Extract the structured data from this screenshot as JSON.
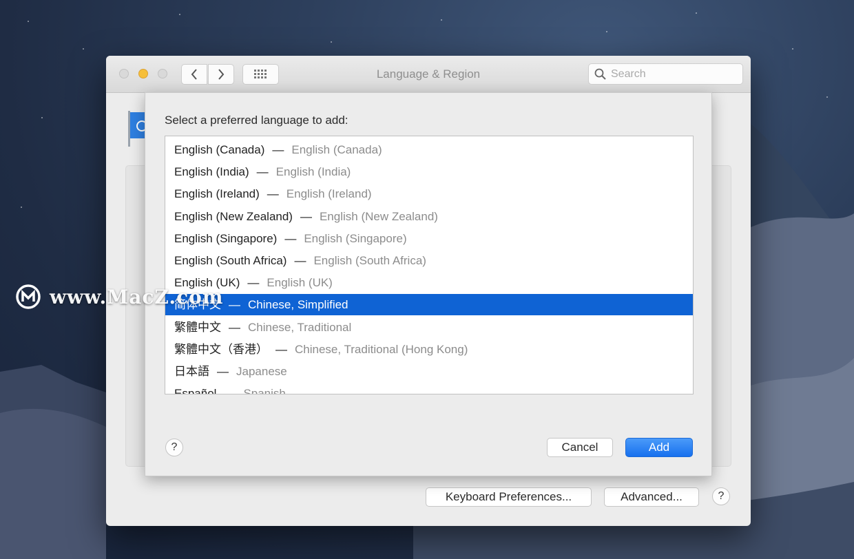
{
  "window": {
    "title": "Language & Region",
    "search_placeholder": "Search"
  },
  "sheet": {
    "prompt": "Select a preferred language to add:",
    "languages": [
      {
        "native": "English (Canada)",
        "english": "English (Canada)",
        "selected": false
      },
      {
        "native": "English (India)",
        "english": "English (India)",
        "selected": false
      },
      {
        "native": "English (Ireland)",
        "english": "English (Ireland)",
        "selected": false
      },
      {
        "native": "English (New Zealand)",
        "english": "English (New Zealand)",
        "selected": false
      },
      {
        "native": "English (Singapore)",
        "english": "English (Singapore)",
        "selected": false
      },
      {
        "native": "English (South Africa)",
        "english": "English (South Africa)",
        "selected": false
      },
      {
        "native": "English (UK)",
        "english": "English (UK)",
        "selected": false
      },
      {
        "native": "简体中文",
        "english": "Chinese, Simplified",
        "selected": true
      },
      {
        "native": "繁體中文",
        "english": "Chinese, Traditional",
        "selected": false
      },
      {
        "native": "繁體中文（香港）",
        "english": "Chinese, Traditional (Hong Kong)",
        "selected": false
      },
      {
        "native": "日本語",
        "english": "Japanese",
        "selected": false
      },
      {
        "native": "Español",
        "english": "Spanish",
        "selected": false
      }
    ],
    "separator": "—",
    "help_label": "?",
    "cancel_label": "Cancel",
    "add_label": "Add"
  },
  "footer": {
    "keyboard_prefs_label": "Keyboard Preferences...",
    "advanced_label": "Advanced...",
    "help_label": "?"
  },
  "watermark": {
    "text": "www.MacZ.com"
  },
  "colors": {
    "selection": "#0f63d4",
    "primary_button": "#1770ee",
    "minimize_light": "#f6bf3a"
  }
}
